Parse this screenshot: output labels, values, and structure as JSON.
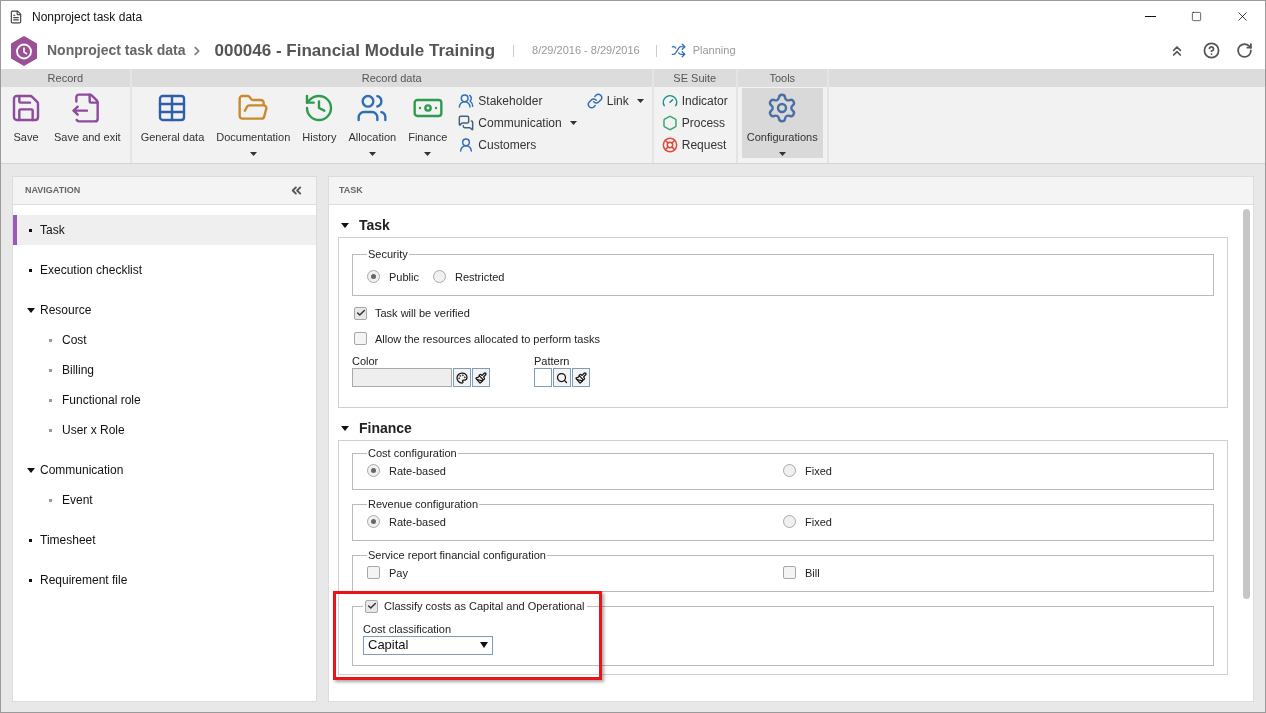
{
  "window": {
    "title": "Nonproject task data"
  },
  "header": {
    "module": "Nonproject task data",
    "record": "000046 - Financial Module Training",
    "dates": "8/29/2016 - 8/29/2016",
    "status": "Planning"
  },
  "ribbon": [
    {
      "label": "Record",
      "large": [
        {
          "label": "Save",
          "dropdown": false,
          "selected": false
        },
        {
          "label": "Save and exit",
          "dropdown": false,
          "selected": false
        }
      ]
    },
    {
      "label": "Record data",
      "large": [
        {
          "label": "General data",
          "dropdown": false,
          "selected": false
        },
        {
          "label": "Documentation",
          "dropdown": true,
          "selected": false
        },
        {
          "label": "History",
          "dropdown": false,
          "selected": false
        },
        {
          "label": "Allocation",
          "dropdown": true,
          "selected": false
        },
        {
          "label": "Finance",
          "dropdown": true,
          "selected": false
        }
      ],
      "small_columns": [
        [
          {
            "label": "Stakeholder",
            "dropdown": false
          },
          {
            "label": "Communication",
            "dropdown": true
          },
          {
            "label": "Customers",
            "dropdown": false
          }
        ],
        [
          {
            "label": "Link",
            "dropdown": true
          }
        ]
      ]
    },
    {
      "label": "SE Suite",
      "small_columns": [
        [
          {
            "label": "Indicator",
            "dropdown": false
          },
          {
            "label": "Process",
            "dropdown": false
          },
          {
            "label": "Request",
            "dropdown": false
          }
        ]
      ]
    },
    {
      "label": "Tools",
      "large": [
        {
          "label": "Configurations",
          "dropdown": true,
          "selected": true
        }
      ]
    }
  ],
  "nav": {
    "title": "NAVIGATION",
    "items": [
      {
        "label": "Task",
        "selected": true
      },
      {
        "label": "Execution checklist",
        "selected": false
      },
      {
        "label": "Resource",
        "selected": false,
        "expanded": true,
        "children": [
          {
            "label": "Cost",
            "selected": false
          },
          {
            "label": "Billing",
            "selected": false
          },
          {
            "label": "Functional role",
            "selected": false
          },
          {
            "label": "User x Role",
            "selected": false
          }
        ]
      },
      {
        "label": "Communication",
        "selected": false,
        "expanded": true,
        "children": [
          {
            "label": "Event",
            "selected": false
          }
        ]
      },
      {
        "label": "Timesheet",
        "selected": false
      },
      {
        "label": "Requirement file",
        "selected": false
      }
    ]
  },
  "main": {
    "title": "TASK",
    "sections": [
      {
        "title": "Task",
        "expanded": true,
        "blocks": [
          {
            "kind": "radio-inline",
            "legend": "Security",
            "options": [
              {
                "label": "Public",
                "selected": true
              },
              {
                "label": "Restricted",
                "selected": false
              }
            ]
          },
          {
            "kind": "checkbox",
            "label": "Task will be verified",
            "checked": true
          },
          {
            "kind": "checkbox",
            "label": "Allow the resources allocated to perform tasks",
            "checked": false
          },
          {
            "kind": "color-pattern",
            "color_label": "Color",
            "pattern_label": "Pattern"
          }
        ]
      },
      {
        "title": "Finance",
        "expanded": true,
        "blocks": [
          {
            "kind": "radio-columns",
            "legend": "Cost configuration",
            "options": [
              {
                "label": "Rate-based",
                "selected": true
              },
              {
                "label": "Fixed",
                "selected": false
              }
            ]
          },
          {
            "kind": "radio-columns",
            "legend": "Revenue configuration",
            "options": [
              {
                "label": "Rate-based",
                "selected": true
              },
              {
                "label": "Fixed",
                "selected": false
              }
            ]
          },
          {
            "kind": "checkbox-columns",
            "legend": "Service report financial configuration",
            "options": [
              {
                "label": "Pay",
                "checked": false
              },
              {
                "label": "Bill",
                "checked": false
              }
            ]
          },
          {
            "kind": "checked-fieldset",
            "legend": "Classify costs as Capital and Operational",
            "checked": true,
            "highlighted": true,
            "field_label": "Cost classification",
            "value": "Capital"
          }
        ]
      }
    ]
  }
}
